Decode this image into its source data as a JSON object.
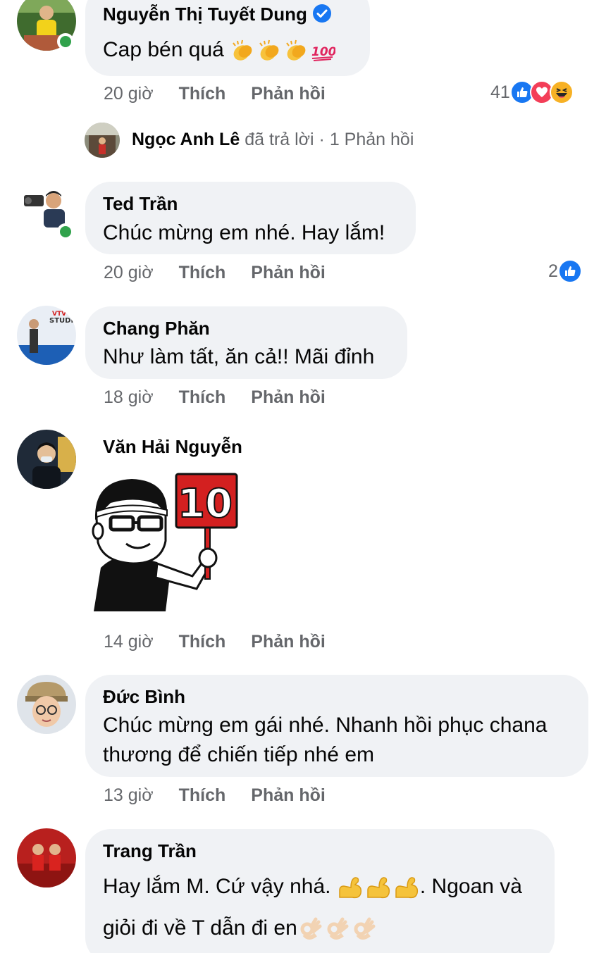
{
  "comments": [
    {
      "author": "Nguyễn Thị Tuyết Dung",
      "text": "Cap bén quá",
      "text_emojis": [
        "clapping-hands",
        "clapping-hands",
        "clapping-hands",
        "hundred-points"
      ],
      "time": "20 giờ",
      "like_label": "Thích",
      "reply_label": "Phản hồi",
      "reaction_count": "41",
      "reactions": [
        "like",
        "love",
        "haha"
      ]
    },
    {
      "author": "Ted Trần",
      "text": "Chúc mừng em nhé. Hay lắm!",
      "time": "20 giờ",
      "like_label": "Thích",
      "reply_label": "Phản hồi",
      "reaction_count": "2",
      "reactions": [
        "like"
      ]
    },
    {
      "author": "Chang Phăn",
      "text": "Như làm tất, ăn cả!! Mãi đỉnh",
      "time": "18 giờ",
      "like_label": "Thích",
      "reply_label": "Phản hồi"
    },
    {
      "author": "Văn Hải Nguyễn",
      "sticker": "score-10-sign-sticker",
      "sticker_text": "10",
      "time": "14 giờ",
      "like_label": "Thích",
      "reply_label": "Phản hồi"
    },
    {
      "author": "Đức Bình",
      "text_line1": "Chúc mừng em gái nhé. Nhanh hồi phục chana",
      "text_line2": "thương để chiến tiếp nhé em",
      "time": "13 giờ",
      "like_label": "Thích",
      "reply_label": "Phản hồi"
    },
    {
      "author": "Trang Trần",
      "text_line1_start": "Hay lắm M. Cứ vậy nhá.",
      "text_line1_emojis": [
        "flexed-biceps",
        "flexed-biceps",
        "flexed-biceps"
      ],
      "text_line1_end": ". Ngoan và",
      "text_line2": "giỏi đi về T dẫn đi en",
      "text_line2_emojis": [
        "ok-hand",
        "ok-hand",
        "ok-hand"
      ]
    }
  ],
  "reply_summary": {
    "name": "Ngọc Anh Lê",
    "action": "đã trả lời",
    "separator": "·",
    "count_label": "1 Phản hồi"
  },
  "colors": {
    "bubble": "#f0f2f5",
    "meta_text": "#65676b",
    "like_blue": "#1877f2",
    "love_red": "#f33e58",
    "haha_yellow": "#f7b125",
    "online_green": "#31a24c"
  }
}
